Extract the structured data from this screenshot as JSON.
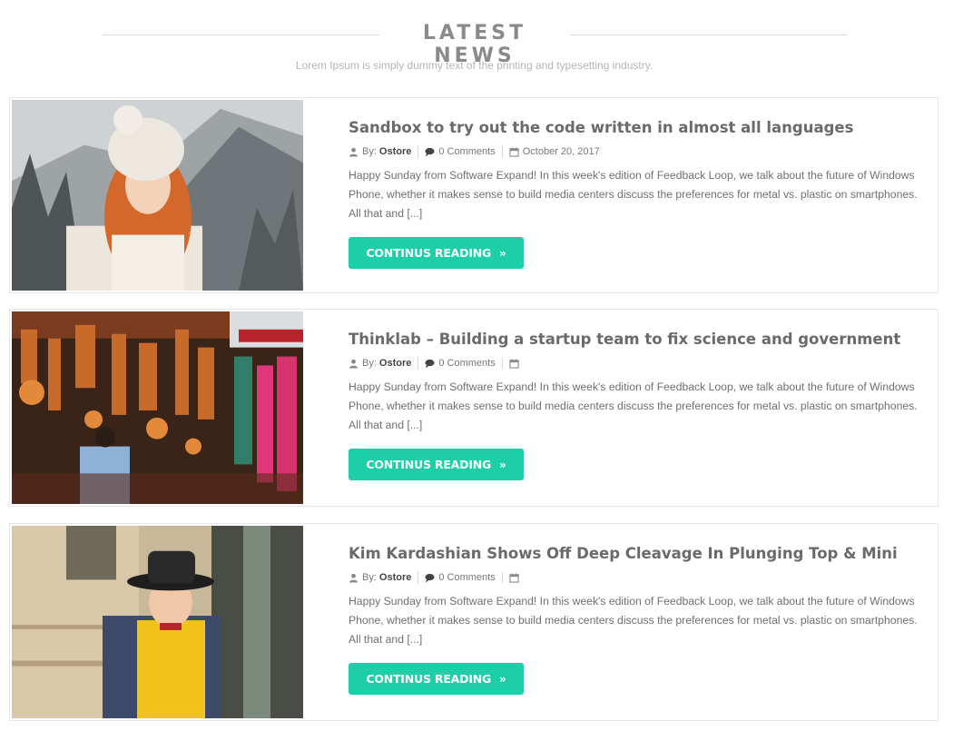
{
  "header": {
    "title": "LATEST NEWS",
    "subtitle": "Lorem Ipsum is simply dummy text of the printing and typesetting industry."
  },
  "posts": [
    {
      "title": "Sandbox to try out the code written in almost all languages",
      "by_label": "By:",
      "author": "Ostore",
      "comments": "0 Comments",
      "date": "October 20, 2017",
      "excerpt": "Happy Sunday from Software Expand! In this week's edition of Feedback Loop, we talk about the future of Windows Phone, whether it makes sense to build media centers discuss the preferences for metal vs. plastic on smartphones. All that and [...]",
      "button": "CONTINUS READING"
    },
    {
      "title": "Thinklab – Building a startup team to fix science and government",
      "by_label": "By:",
      "author": "Ostore",
      "comments": "0 Comments",
      "date": "",
      "excerpt": "Happy Sunday from Software Expand! In this week's edition of Feedback Loop, we talk about the future of Windows Phone, whether it makes sense to build media centers discuss the preferences for metal vs. plastic on smartphones. All that and [...]",
      "button": "CONTINUS READING"
    },
    {
      "title": "Kim Kardashian Shows Off Deep Cleavage In Plunging Top & Mini",
      "by_label": "By:",
      "author": "Ostore",
      "comments": "0 Comments",
      "date": "",
      "excerpt": "Happy Sunday from Software Expand! In this week's edition of Feedback Loop, we talk about the future of Windows Phone, whether it makes sense to build media centers discuss the preferences for metal vs. plastic on smartphones. All that and [...]",
      "button": "CONTINUS READING"
    }
  ],
  "icons": {
    "author": "user-icon",
    "comments": "comment-icon",
    "date": "calendar-icon",
    "button": "double-chevron-right-icon"
  },
  "colors": {
    "accent": "#1ccfa8",
    "title": "#6a6a6a",
    "heading": "#8a8a8a"
  }
}
